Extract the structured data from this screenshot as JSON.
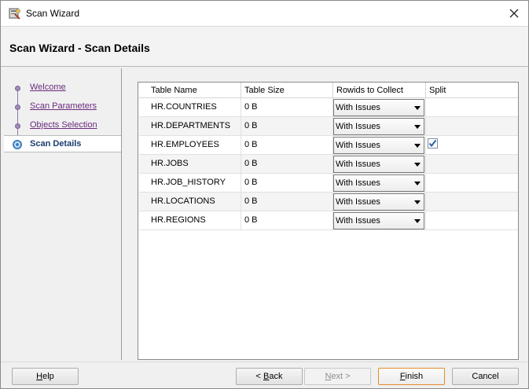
{
  "window": {
    "title": "Scan Wizard",
    "close_icon": "close-icon",
    "app_icon": "wizard-app-icon"
  },
  "header": {
    "title": "Scan Wizard - Scan Details"
  },
  "nav": {
    "items": [
      {
        "label": "Welcome",
        "active": false
      },
      {
        "label": "Scan Parameters",
        "active": false
      },
      {
        "label": "Objects Selection",
        "active": false
      },
      {
        "label": "Scan Details",
        "active": true
      }
    ]
  },
  "table": {
    "columns": [
      "Table Name",
      "Table Size",
      "Rowids to Collect",
      "Split"
    ],
    "rows": [
      {
        "name": "HR.COUNTRIES",
        "size": "0 B",
        "rowids": "With Issues",
        "split": false
      },
      {
        "name": "HR.DEPARTMENTS",
        "size": "0 B",
        "rowids": "With Issues",
        "split": false
      },
      {
        "name": "HR.EMPLOYEES",
        "size": "0 B",
        "rowids": "With Issues",
        "split": true
      },
      {
        "name": "HR.JOBS",
        "size": "0 B",
        "rowids": "With Issues",
        "split": false
      },
      {
        "name": "HR.JOB_HISTORY",
        "size": "0 B",
        "rowids": "With Issues",
        "split": false
      },
      {
        "name": "HR.LOCATIONS",
        "size": "0 B",
        "rowids": "With Issues",
        "split": false
      },
      {
        "name": "HR.REGIONS",
        "size": "0 B",
        "rowids": "With Issues",
        "split": false
      }
    ]
  },
  "buttons": {
    "help": {
      "mnemonic": "H",
      "rest": "elp"
    },
    "back": {
      "prefix": "< ",
      "mnemonic": "B",
      "rest": "ack"
    },
    "next": {
      "mnemonic": "N",
      "rest": "ext >"
    },
    "finish": {
      "mnemonic": "F",
      "rest": "inish"
    },
    "cancel": {
      "label": "Cancel"
    }
  },
  "colors": {
    "accent_default_button": "#e48c2e",
    "nav_link": "#6a2b7e",
    "nav_active": "#1b3d6e"
  }
}
